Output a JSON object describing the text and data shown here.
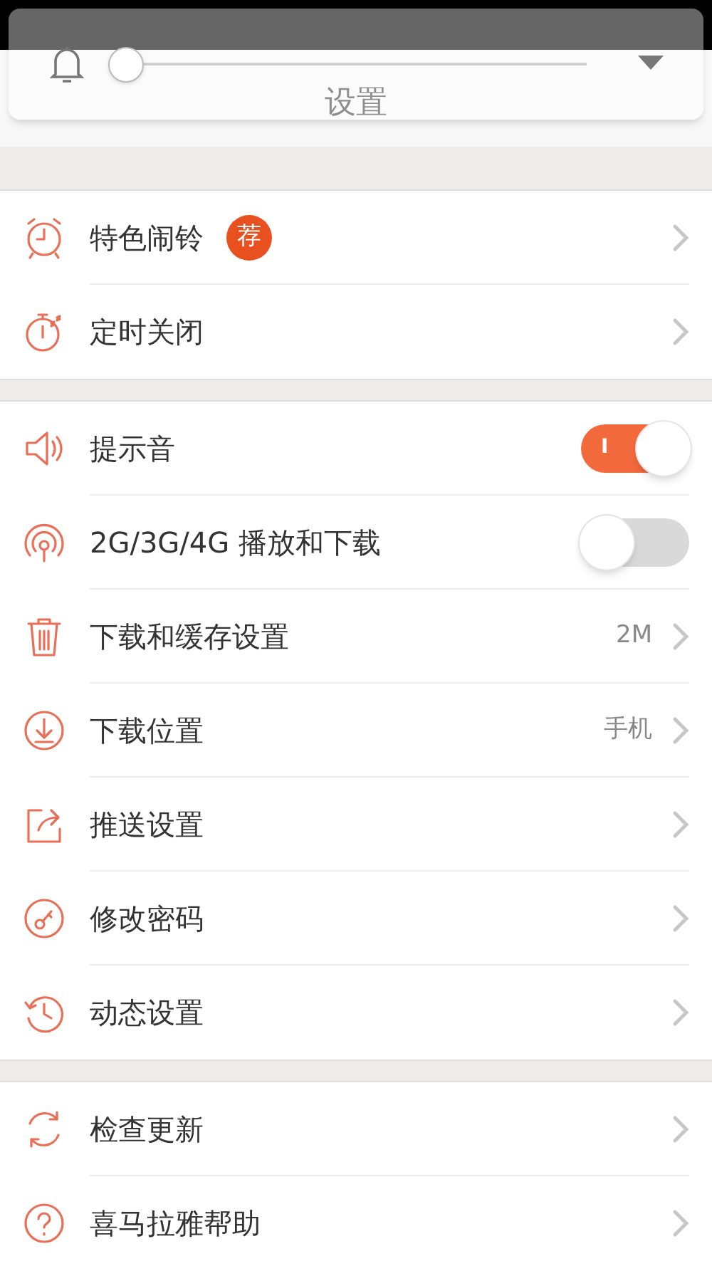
{
  "header": {
    "title": "设置"
  },
  "volume_popup": {
    "level": 0
  },
  "groups": [
    {
      "rows": [
        {
          "kind": "link",
          "label": "特色闹铃",
          "badge": "荐"
        },
        {
          "kind": "link",
          "label": "定时关闭"
        }
      ]
    },
    {
      "rows": [
        {
          "kind": "toggle",
          "label": "提示音",
          "on": true,
          "switch_text": "I"
        },
        {
          "kind": "toggle",
          "label": "2G/3G/4G 播放和下载",
          "on": false
        },
        {
          "kind": "link",
          "label": "下载和缓存设置",
          "value": "2M"
        },
        {
          "kind": "link",
          "label": "下载位置",
          "value": "手机"
        },
        {
          "kind": "link",
          "label": "推送设置"
        },
        {
          "kind": "link",
          "label": "修改密码"
        },
        {
          "kind": "link",
          "label": "动态设置"
        }
      ]
    },
    {
      "rows": [
        {
          "kind": "link",
          "label": "检查更新"
        },
        {
          "kind": "link",
          "label": "喜马拉雅帮助"
        }
      ]
    }
  ]
}
